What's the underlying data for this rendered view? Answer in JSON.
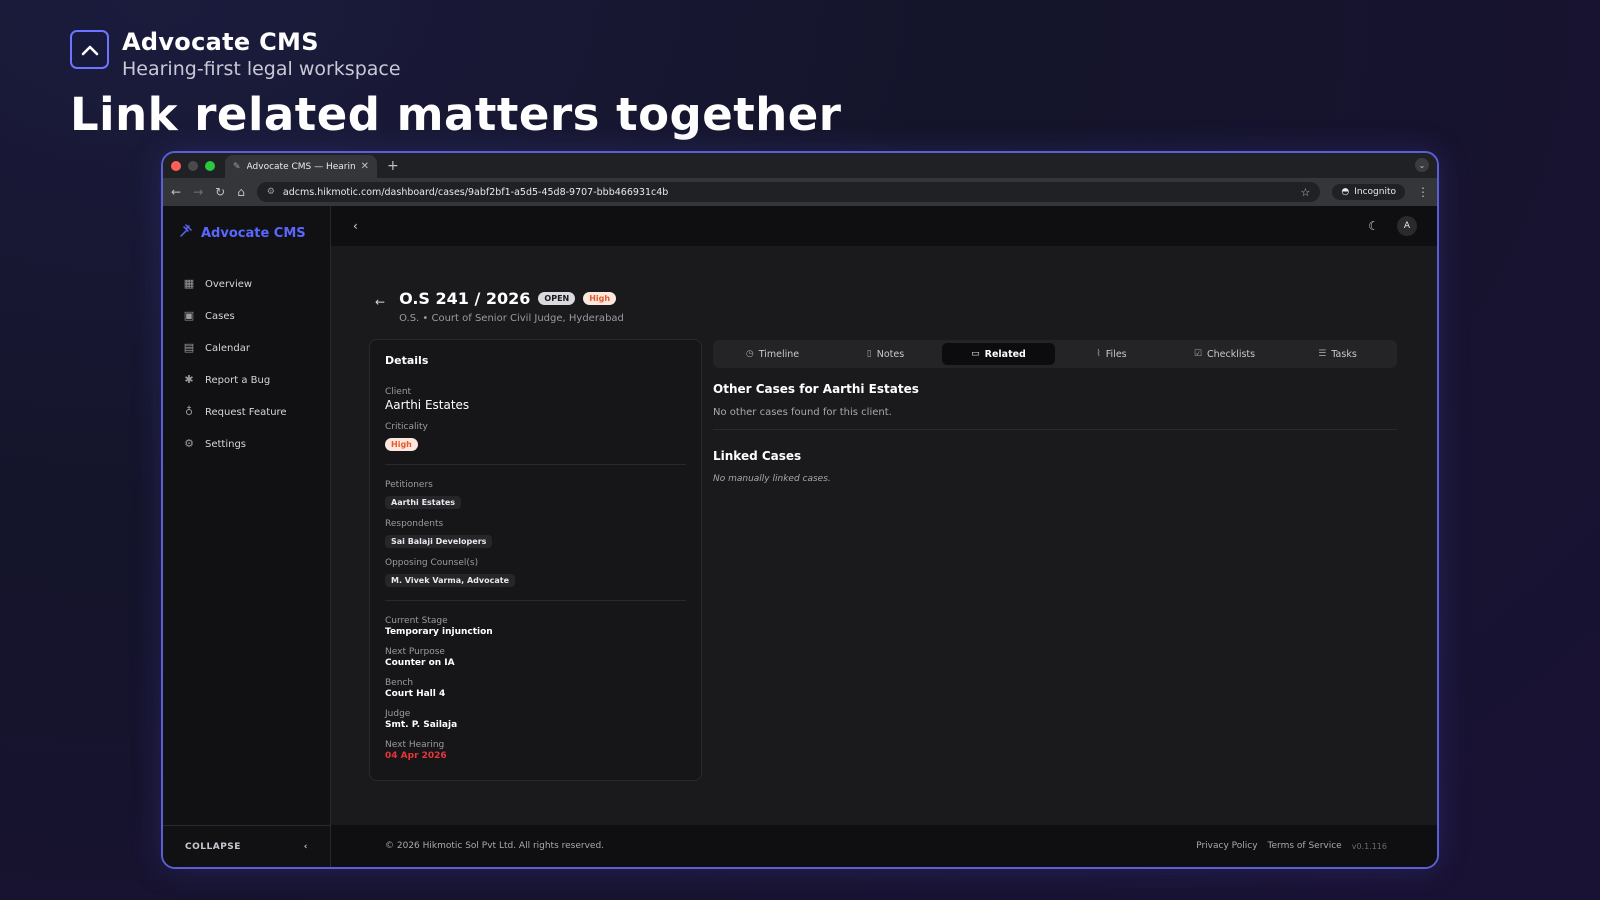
{
  "promo": {
    "brand_name": "Advocate CMS",
    "tagline": "Hearing-first legal workspace",
    "headline": "Link related matters together"
  },
  "browser": {
    "tab_title": "Advocate CMS — Hearing-Fi",
    "url": "adcms.hikmotic.com/dashboard/cases/9abf2bf1-a5d5-45d8-9707-bbb466931c4b",
    "incognito_label": "Incognito"
  },
  "sidebar": {
    "brand": "Advocate CMS",
    "items": [
      {
        "label": "Overview",
        "icon": "grid-icon"
      },
      {
        "label": "Cases",
        "icon": "briefcase-icon"
      },
      {
        "label": "Calendar",
        "icon": "calendar-icon"
      },
      {
        "label": "Report a Bug",
        "icon": "bug-icon"
      },
      {
        "label": "Request Feature",
        "icon": "lightbulb-icon"
      },
      {
        "label": "Settings",
        "icon": "gear-icon"
      }
    ],
    "collapse_label": "COLLAPSE"
  },
  "topbar": {
    "avatar_initial": "A"
  },
  "case": {
    "number": "O.S 241 / 2026",
    "status_badge": "OPEN",
    "priority_badge": "High",
    "subtitle": "O.S. • Court of Senior Civil Judge, Hyderabad"
  },
  "details": {
    "heading": "Details",
    "client_label": "Client",
    "client_value": "Aarthi Estates",
    "criticality_label": "Criticality",
    "criticality_value": "High",
    "petitioners_label": "Petitioners",
    "petitioners_value": "Aarthi Estates",
    "respondents_label": "Respondents",
    "respondents_value": "Sai Balaji Developers",
    "counsel_label": "Opposing Counsel(s)",
    "counsel_value": "M. Vivek Varma, Advocate",
    "stage_label": "Current Stage",
    "stage_value": "Temporary injunction",
    "purpose_label": "Next Purpose",
    "purpose_value": "Counter on IA",
    "bench_label": "Bench",
    "bench_value": "Court Hall 4",
    "judge_label": "Judge",
    "judge_value": "Smt. P. Sailaja",
    "hearing_label": "Next Hearing",
    "hearing_value": "04 Apr 2026"
  },
  "tabs": [
    {
      "label": "Timeline",
      "icon": "clock-icon"
    },
    {
      "label": "Notes",
      "icon": "document-icon"
    },
    {
      "label": "Related",
      "icon": "folder-icon",
      "active": true
    },
    {
      "label": "Files",
      "icon": "paperclip-icon"
    },
    {
      "label": "Checklists",
      "icon": "checkbox-icon"
    },
    {
      "label": "Tasks",
      "icon": "list-icon"
    }
  ],
  "related": {
    "other_cases_heading": "Other Cases for Aarthi Estates",
    "other_cases_empty": "No other cases found for this client.",
    "linked_heading": "Linked Cases",
    "linked_empty": "No manually linked cases."
  },
  "footer": {
    "copyright": "© 2026 Hikmotic Sol Pvt Ltd. All rights reserved.",
    "privacy": "Privacy Policy",
    "terms": "Terms of Service",
    "version": "v0.1.116"
  },
  "colors": {
    "accent": "#5a67ff",
    "high_badge": "#e85a2a",
    "hearing_date": "#e5363a"
  }
}
